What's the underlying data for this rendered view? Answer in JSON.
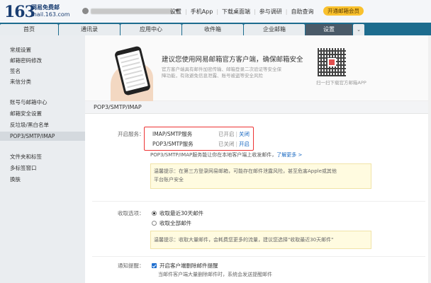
{
  "header": {
    "logo_main": "163",
    "logo_line1": "网易免费邮",
    "logo_line2": "mail.163.com",
    "links": [
      "设置",
      "手机App",
      "下载桌面端",
      "参与调研",
      "自助查询"
    ],
    "vip": "开通邮箱会员"
  },
  "nav": {
    "tabs": [
      "首页",
      "通讯录",
      "应用中心",
      "收件箱",
      "企业邮箱",
      "设置"
    ],
    "active": "设置"
  },
  "sidebar": {
    "items": [
      "常规设置",
      "邮箱密码修改",
      "签名",
      "来信分类",
      "账号与邮箱中心",
      "邮箱安全设置",
      "反垃圾/黑白名单",
      "POP3/SMTP/IMAP",
      "文件夹和标签",
      "多标签窗口",
      "换肤"
    ]
  },
  "promo": {
    "title": "建议您使用网易邮箱官方客户端，确保邮箱安全",
    "desc": "官方客户端具有邮件加密传输、邮箱登录二次验证等安全保障功能，有效避免信息泄露、账号被盗等安全风险",
    "qr_caption": "扫一扫下载官方邮箱APP"
  },
  "section": {
    "title": "POP3/SMTP/IMAP",
    "enable_label": "开启服务：",
    "services": [
      {
        "name": "IMAP/SMTP服务",
        "state": "已开启",
        "action": "关闭"
      },
      {
        "name": "POP3/SMTP服务",
        "state": "已关闭",
        "action": "开启"
      }
    ],
    "note": "POP3/SMTP/IMAP服务能让你在本地客户端上收发邮件，",
    "learn_more": "了解更多 >",
    "tip1_line1": "温馨提示：在第三方登录网易邮箱，可能存在邮件泄露风险，甚至危害Apple或其他",
    "tip1_line2": "平台账户安全",
    "receive_label": "收取选项：",
    "receive_options": [
      "收取最近30天邮件",
      "收取全部邮件"
    ],
    "receive_selected": 0,
    "tip2": "温馨提示：收取大量邮件，会耗费您更多的流量，建议您选择\"收取最近30天邮件\"",
    "notify_label": "通知提醒：",
    "notify_checkbox": "开启客户端删除邮件提醒",
    "notify_sub": "当邮件客户端大量删除邮件时，系统会发送提醒邮件"
  }
}
